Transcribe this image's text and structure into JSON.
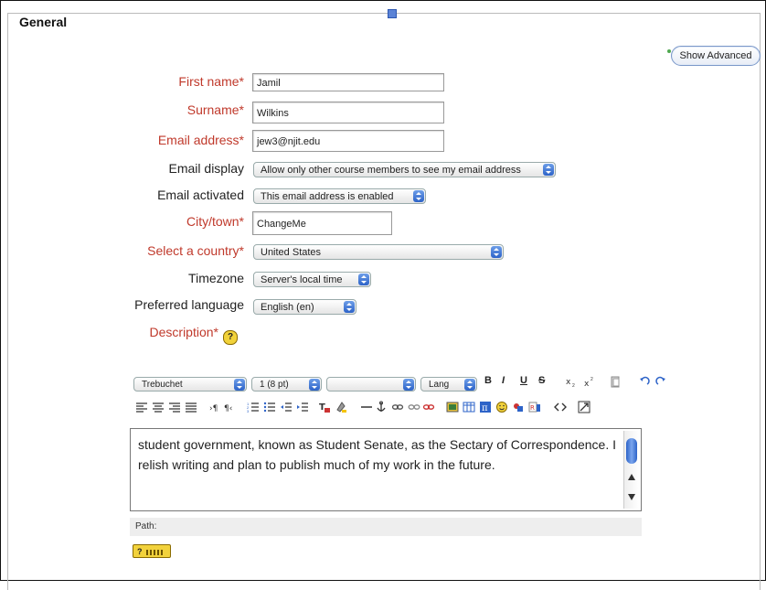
{
  "section": {
    "legend": "General"
  },
  "advanced_button": "Show Advanced",
  "fields": {
    "firstname": {
      "label": "First name*",
      "value": "Jamil"
    },
    "surname": {
      "label": "Surname*",
      "value": "Wilkins"
    },
    "email": {
      "label": "Email address*",
      "value": "jew3@njit.edu"
    },
    "email_display": {
      "label": "Email display",
      "value": "Allow only other course members to see my email address"
    },
    "email_activated": {
      "label": "Email activated",
      "value": "This email address is enabled"
    },
    "city": {
      "label": "City/town*",
      "value": "ChangeMe"
    },
    "country": {
      "label": "Select a country*",
      "value": "United States"
    },
    "timezone": {
      "label": "Timezone",
      "value": "Server's local time"
    },
    "language": {
      "label": "Preferred language",
      "value": "English (en)"
    },
    "description": {
      "label": "Description*"
    }
  },
  "editor": {
    "font": "Trebuchet",
    "size": "1 (8 pt)",
    "format": "",
    "lang": "Lang",
    "text": "student government, known as Student Senate, as the Sectary of Correspondence. I relish writing and plan to publish much of my work in the future.",
    "path_label": "Path:",
    "buttons": {
      "bold": "B",
      "italic": "I",
      "underline": "U",
      "strike": "S"
    }
  },
  "colors": {
    "required": "#c0392b",
    "accent": "#2d63c8"
  }
}
